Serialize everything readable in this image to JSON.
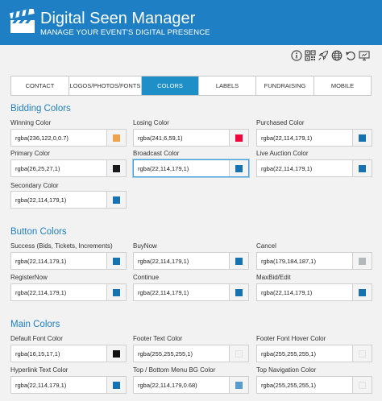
{
  "header": {
    "title": "Digital Seen Manager",
    "subtitle": "MANAGE YOUR EVENT'S DIGITAL PRESENCE",
    "logo_icon": "clapperboard-icon",
    "color": "#1f7fc4"
  },
  "toolbar": {
    "icons": [
      "info-icon",
      "qr-code-icon",
      "rocket-icon",
      "globe-icon",
      "undo-icon",
      "monitor-icon"
    ]
  },
  "tabs": [
    {
      "label": "CONTACT",
      "active": false
    },
    {
      "label": "LOGOS/PHOTOS/FONTS",
      "active": false
    },
    {
      "label": "COLORS",
      "active": true
    },
    {
      "label": "LABELS",
      "active": false
    },
    {
      "label": "FUNDRAISING",
      "active": false
    },
    {
      "label": "MOBILE",
      "active": false
    }
  ],
  "sections": [
    {
      "title": "Bidding Colors",
      "fields": [
        {
          "label": "Winning Color",
          "value": "rgba(236,122,0,0.7)",
          "swatch": "#f0a24c"
        },
        {
          "label": "Losing Color",
          "value": "rgba(241,6,59,1)",
          "swatch": "#f1063b"
        },
        {
          "label": "Purchased Color",
          "value": "rgba(22,114,179,1)",
          "swatch": "#1672b3"
        },
        {
          "label": "Primary Color",
          "value": "rgba(26,25,27,1)",
          "swatch": "#1a191b"
        },
        {
          "label": "Broadcast Color",
          "value": "rgba(22,114,179,1)",
          "swatch": "#1672b3"
        },
        {
          "label": "Live Auction Color",
          "value": "rgba(22,114,179,1)",
          "swatch": "#1672b3"
        },
        {
          "label": "Secondary Color",
          "value": "rgba(22,114,179,1)",
          "swatch": "#1672b3"
        }
      ]
    },
    {
      "title": "Button Colors",
      "fields": [
        {
          "label": "Success (Bids, Tickets, Increments)",
          "value": "rgba(22,114,179,1)",
          "swatch": "#1672b3"
        },
        {
          "label": "BuyNow",
          "value": "rgba(22,114,179,1)",
          "swatch": "#1672b3"
        },
        {
          "label": "Cancel",
          "value": "rgba(179,184,187,1)",
          "swatch": "#b3b8bb"
        },
        {
          "label": "RegisterNow",
          "value": "rgba(22,114,179,1)",
          "swatch": "#1672b3"
        },
        {
          "label": "Continue",
          "value": "rgba(22,114,179,1)",
          "swatch": "#1672b3"
        },
        {
          "label": "MaxBid/Edit",
          "value": "rgba(22,114,179,1)",
          "swatch": "#1672b3"
        }
      ]
    },
    {
      "title": "Main Colors",
      "fields": [
        {
          "label": "Default Font Color",
          "value": "rgba(16,15,17,1)",
          "swatch": "#100f11"
        },
        {
          "label": "Footer Text Color",
          "value": "rgba(255,255,255,1)",
          "swatch": "#f2f2f2"
        },
        {
          "label": "Footer Font Hover Color",
          "value": "rgba(255,255,255,1)",
          "swatch": "#f2f2f2"
        },
        {
          "label": "Hyperlink Text Color",
          "value": "rgba(22,114,179,1)",
          "swatch": "#1672b3"
        },
        {
          "label": "Top / Bottom Menu BG Color",
          "value": "rgba(22,114,179,0.68)",
          "swatch": "#5a9bcd"
        },
        {
          "label": "Top Navigation Color",
          "value": "rgba(255,255,255,1)",
          "swatch": "#f2f2f2"
        }
      ]
    }
  ]
}
